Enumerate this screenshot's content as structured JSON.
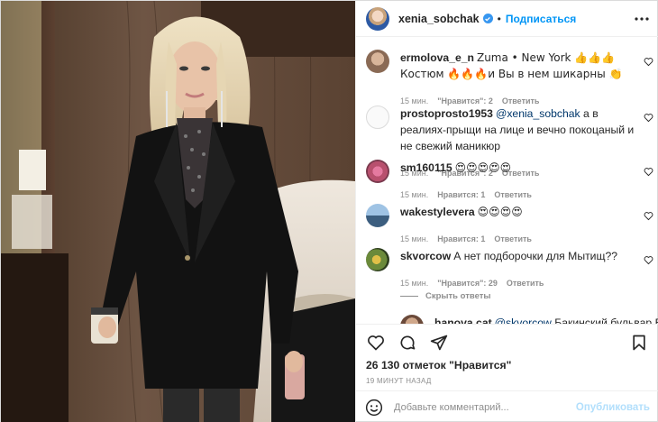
{
  "post": {
    "author": "xenia_sobchak",
    "follow_label": "Подписаться",
    "more_icon": "more-horizontal-icon"
  },
  "comments": [
    {
      "user": "ermolova_e_n",
      "text": "Zuma • New York 👍👍👍 Костюм 🔥🔥🔥и Вы в нем шикарны 👏",
      "time": "15 мин.",
      "likes": "\"Нравится\": 2",
      "reply": "Ответить"
    },
    {
      "user": "prostoprosto1953",
      "mention": "@xenia_sobchak",
      "text": " а в реалиях-прыщи на лице и вечно покоцаный и не свежий маникюр",
      "time": "15 мин.",
      "likes": "\"Нравится\": 2",
      "reply": "Ответить"
    },
    {
      "user": "sm160115",
      "text": "😍😍😍😍😍",
      "time": "15 мин.",
      "likes": "Нравится: 1",
      "reply": "Ответить"
    },
    {
      "user": "wakestylevera",
      "text": "😍😍😍😍",
      "time": "15 мин.",
      "likes": "Нравится: 1",
      "reply": "Ответить"
    },
    {
      "user": "skvorcow",
      "text": "А нет подборочки для Мытищ??",
      "time": "15 мин.",
      "likes": "\"Нравится\": 29",
      "reply": "Ответить"
    },
    {
      "user": "hanova.cat",
      "mention": "@skvorcow",
      "text": " Бакинский бульвар Веранда"
    }
  ],
  "replies_toggle": "Скрыть ответы",
  "likes_count": "26 130 отметок \"Нравится\"",
  "time_ago": "19 минут назад",
  "add_comment": {
    "placeholder": "Добавьте комментарий...",
    "publish_label": "Опубликовать"
  },
  "colors": {
    "accent": "#0095f6",
    "publish_disabled": "#b2dffc",
    "muted": "#8e8e8e"
  }
}
